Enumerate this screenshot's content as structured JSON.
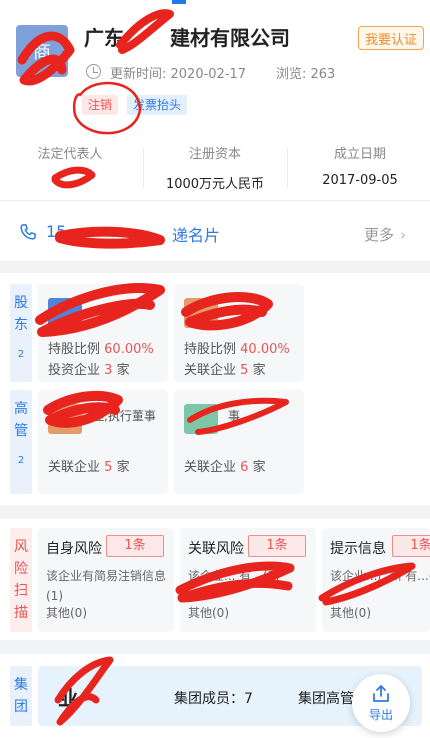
{
  "header": {
    "company_name": "广东",
    "company_suffix": "建材有限公司",
    "logo_text": "商",
    "certify_label": "我要认证",
    "update_label": "更新时间: 2020-02-17",
    "views_label": "浏览: 263",
    "tags": [
      "注销",
      "发票抬头"
    ]
  },
  "info": {
    "legal_rep_label": "法定代表人",
    "capital_label": "注册资本",
    "capital_value": "1000万元人民币",
    "founded_label": "成立日期",
    "founded_value": "2017-09-05"
  },
  "contact": {
    "phone_prefix": "15",
    "card_label": "递名片",
    "more_label": "更多"
  },
  "shareholders": {
    "side_label": [
      "股",
      "东"
    ],
    "count": "2",
    "cards": [
      {
        "ratio_label": "持股比例",
        "ratio": "60.00%",
        "invest_label": "投资企业",
        "invest_count": "3",
        "unit": "家"
      },
      {
        "ratio_label": "持股比例",
        "ratio": "40.00%",
        "invest_label": "关联企业",
        "invest_count": "5",
        "unit": "家"
      }
    ]
  },
  "executives": {
    "side_label": [
      "高",
      "管"
    ],
    "count": "2",
    "cards": [
      {
        "role": "理,执行董事",
        "rel_label": "关联企业",
        "rel_count": "5",
        "unit": "家"
      },
      {
        "role": "事",
        "rel_label": "关联企业",
        "rel_count": "6",
        "unit": "家"
      }
    ]
  },
  "risk": {
    "side_label": [
      "风",
      "险",
      "扫",
      "描"
    ],
    "items": [
      {
        "title": "自身风险",
        "badge": "1条",
        "desc": "该企业有简易注销信息(1)",
        "other": "其他(0)"
      },
      {
        "title": "关联风险",
        "badge": "1条",
        "desc": "该企业... 有...(1)",
        "other": "其他(0)"
      },
      {
        "title": "提示信息",
        "badge": "1条",
        "desc": "该企业...广州 有...(1)",
        "other": "其他(0)"
      }
    ]
  },
  "group": {
    "side_label": [
      "集",
      "团"
    ],
    "name": "业",
    "members_label": "集团成员：7",
    "execs_label": "集团高管",
    "export_label": "导出"
  },
  "colors": {
    "accent_blue": "#2f7be0",
    "risk_red": "#e85656",
    "certify_orange": "#e8902c"
  }
}
